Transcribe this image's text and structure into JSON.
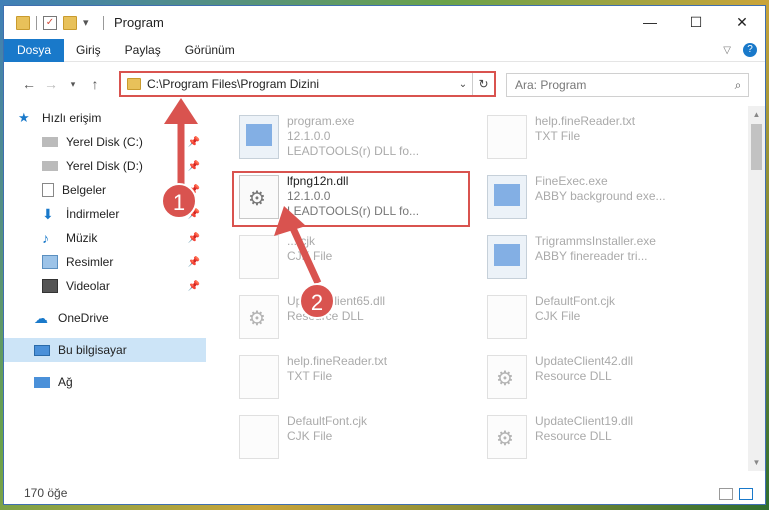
{
  "window": {
    "title": "Program"
  },
  "ribbon": {
    "tabs": [
      "Dosya",
      "Giriş",
      "Paylaş",
      "Görünüm"
    ]
  },
  "address": {
    "path": "C:\\Program Files\\Program Dizini"
  },
  "search": {
    "placeholder": "Ara: Program"
  },
  "sidebar": {
    "items": [
      {
        "label": "Hızlı erişim"
      },
      {
        "label": "Yerel Disk (C:)"
      },
      {
        "label": "Yerel Disk (D:)"
      },
      {
        "label": "Belgeler"
      },
      {
        "label": "İndirmeler"
      },
      {
        "label": "Müzik"
      },
      {
        "label": "Resimler"
      },
      {
        "label": "Videolar"
      },
      {
        "label": "OneDrive"
      },
      {
        "label": "Bu bilgisayar"
      },
      {
        "label": "Ağ"
      }
    ]
  },
  "files": [
    {
      "name": "program.exe",
      "line2": "12.1.0.0",
      "line3": "LEADTOOLS(r) DLL fo..."
    },
    {
      "name": "help.fineReader.txt",
      "line2": "TXT File"
    },
    {
      "name": "lfpng12n.dll",
      "line2": "12.1.0.0",
      "line3": "LEADTOOLS(r) DLL fo..."
    },
    {
      "name": "FineExec.exe",
      "line2": "ABBY background exe..."
    },
    {
      "name": "....cjk",
      "line2": "CJK File"
    },
    {
      "name": "TrigrammsInstaller.exe",
      "line2": "ABBY finereader tri..."
    },
    {
      "name": "UpdateClient65.dll",
      "line2": "Resource DLL"
    },
    {
      "name": "DefaultFont.cjk",
      "line2": "CJK File"
    },
    {
      "name": "help.fineReader.txt",
      "line2": "TXT File"
    },
    {
      "name": "UpdateClient42.dll",
      "line2": "Resource DLL"
    },
    {
      "name": "DefaultFont.cjk",
      "line2": "CJK File"
    },
    {
      "name": "UpdateClient19.dll",
      "line2": "Resource DLL"
    }
  ],
  "status": {
    "count": "170 öğe"
  },
  "annotations": {
    "step1": "1",
    "step2": "2"
  },
  "colors": {
    "accent": "#1979ca",
    "highlight": "#d9534f"
  }
}
